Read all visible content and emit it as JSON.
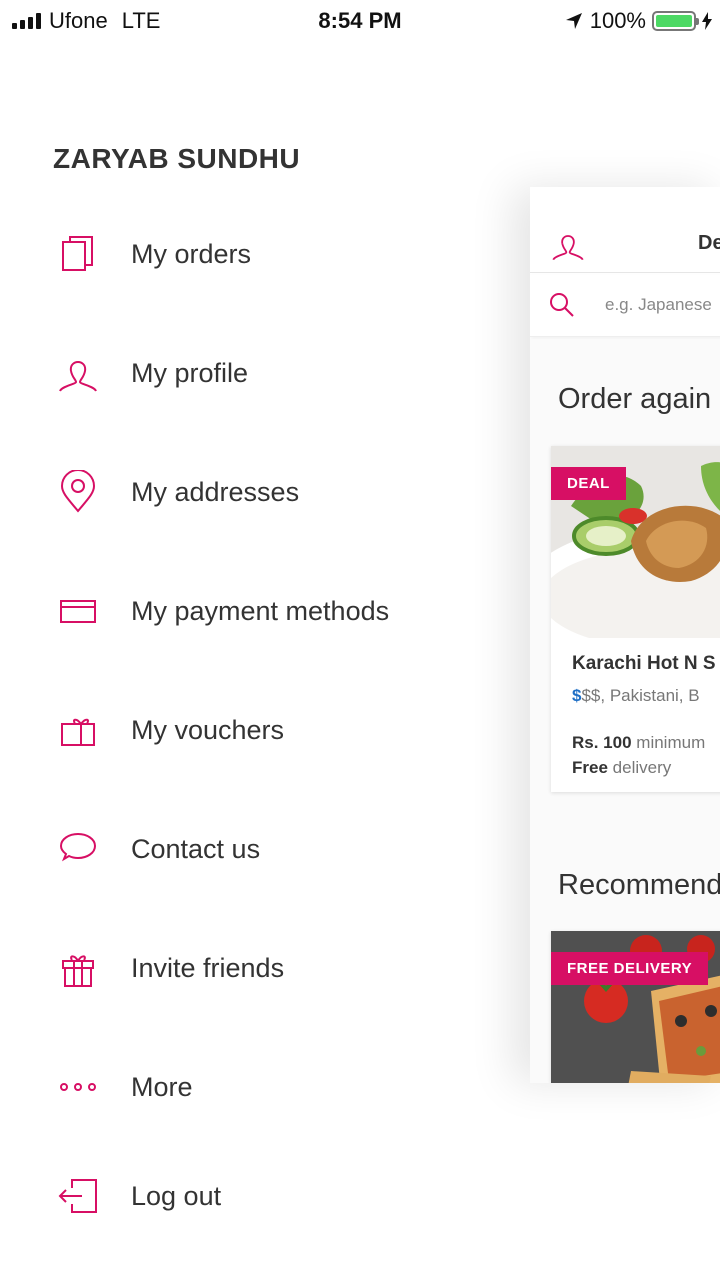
{
  "status_bar": {
    "carrier": "Ufone",
    "network": "LTE",
    "time": "8:54 PM",
    "battery": "100%",
    "battery_level": 1.0
  },
  "drawer": {
    "user_name": "ZARYAB SUNDHU",
    "accent_color": "#d70f64",
    "items": [
      {
        "label": "My orders",
        "icon": "orders-icon"
      },
      {
        "label": "My profile",
        "icon": "profile-icon"
      },
      {
        "label": "My addresses",
        "icon": "location-pin-icon"
      },
      {
        "label": "My payment methods",
        "icon": "credit-card-icon"
      },
      {
        "label": "My vouchers",
        "icon": "voucher-icon"
      },
      {
        "label": "Contact us",
        "icon": "chat-bubble-icon"
      },
      {
        "label": "Invite friends",
        "icon": "gift-icon"
      },
      {
        "label": "More",
        "icon": "more-dots-icon"
      },
      {
        "label": "Log out",
        "icon": "logout-icon"
      }
    ]
  },
  "main_panel": {
    "header_text": "De",
    "search_placeholder": "e.g. Japanese",
    "sections": {
      "order_again": "Order again",
      "recommended": "Recommend"
    },
    "order_again_card": {
      "badge": "DEAL",
      "name": "Karachi Hot N S",
      "price_level_active": "$",
      "tags_rest": "$$, Pakistani, B",
      "minimum_amount": "Rs. 100",
      "minimum_label": "minimum",
      "delivery_amount": "Free",
      "delivery_label": "delivery"
    },
    "recommended_card": {
      "badge": "FREE DELIVERY"
    }
  }
}
